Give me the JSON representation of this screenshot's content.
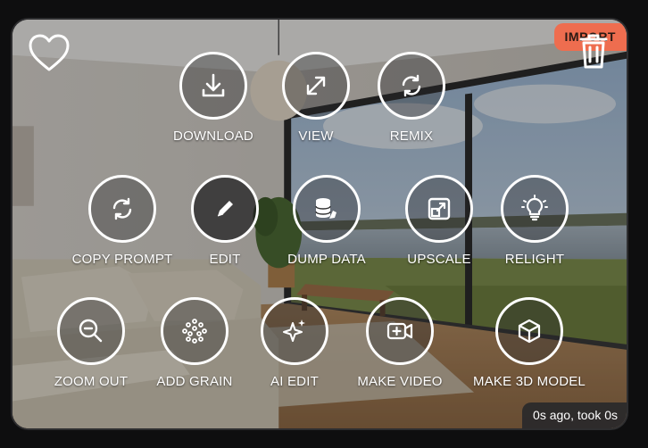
{
  "import_label": "IMPORT",
  "status_text": "0s ago, took 0s",
  "actions": {
    "download": "DOWNLOAD",
    "view": "VIEW",
    "remix": "REMIX",
    "copy_prompt": "COPY PROMPT",
    "edit": "EDIT",
    "dump_data": "DUMP DATA",
    "upscale": "UPSCALE",
    "relight": "RELIGHT",
    "zoom_out": "ZOOM OUT",
    "add_grain": "ADD GRAIN",
    "ai_edit": "AI EDIT",
    "make_video": "MAKE VIDEO",
    "make_3d_model": "MAKE 3D MODEL"
  },
  "colors": {
    "import_badge": "#ee6d4f",
    "icon_stroke": "#ffffff"
  }
}
